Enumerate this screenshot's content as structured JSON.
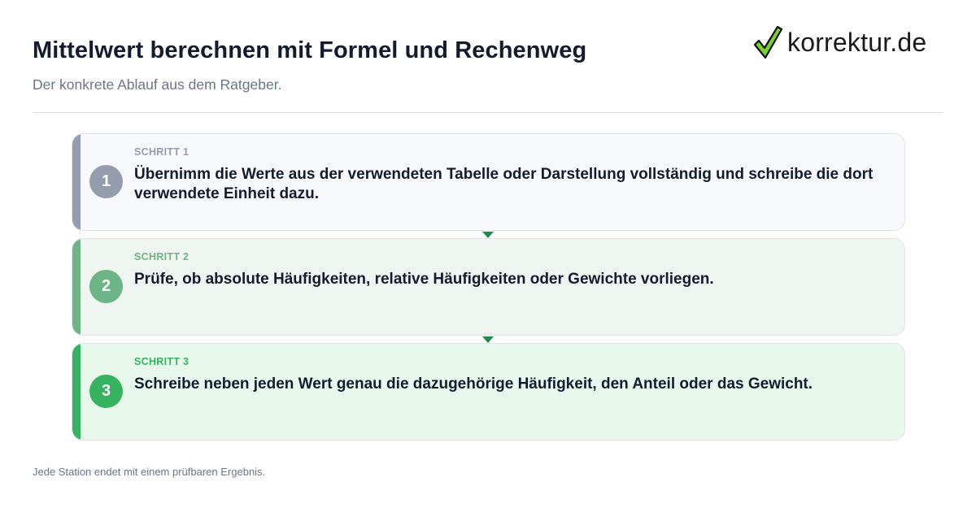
{
  "header": {
    "title": "Mittelwert berechnen mit Formel und Rechenweg",
    "subtitle": "Der konkrete Ablauf aus dem Ratgeber."
  },
  "brand": {
    "name": "korrektur.de",
    "icon": "checkmark-icon",
    "check_color": "#7ad12b"
  },
  "steps": [
    {
      "number": "1",
      "kicker": "SCHRITT 1",
      "text": "Übernimm die Werte aus der verwendeten Tabelle oder Darstellung vollständig und schreibe die dort verwendete Einheit dazu.",
      "color": "#959cad"
    },
    {
      "number": "2",
      "kicker": "SCHRITT 2",
      "text": "Prüfe, ob absolute Häufigkeiten, relative Häufigkeiten oder Gewichte vorliegen.",
      "color": "#6db486"
    },
    {
      "number": "3",
      "kicker": "SCHRITT 3",
      "text": "Schreibe neben jeden Wert genau die dazugehörige Häufigkeit, den Anteil oder das Gewicht.",
      "color": "#35b35f"
    }
  ],
  "connector_color": "#1f8a49",
  "footer": {
    "note": "Jede Station endet mit einem prüfbaren Ergebnis."
  }
}
